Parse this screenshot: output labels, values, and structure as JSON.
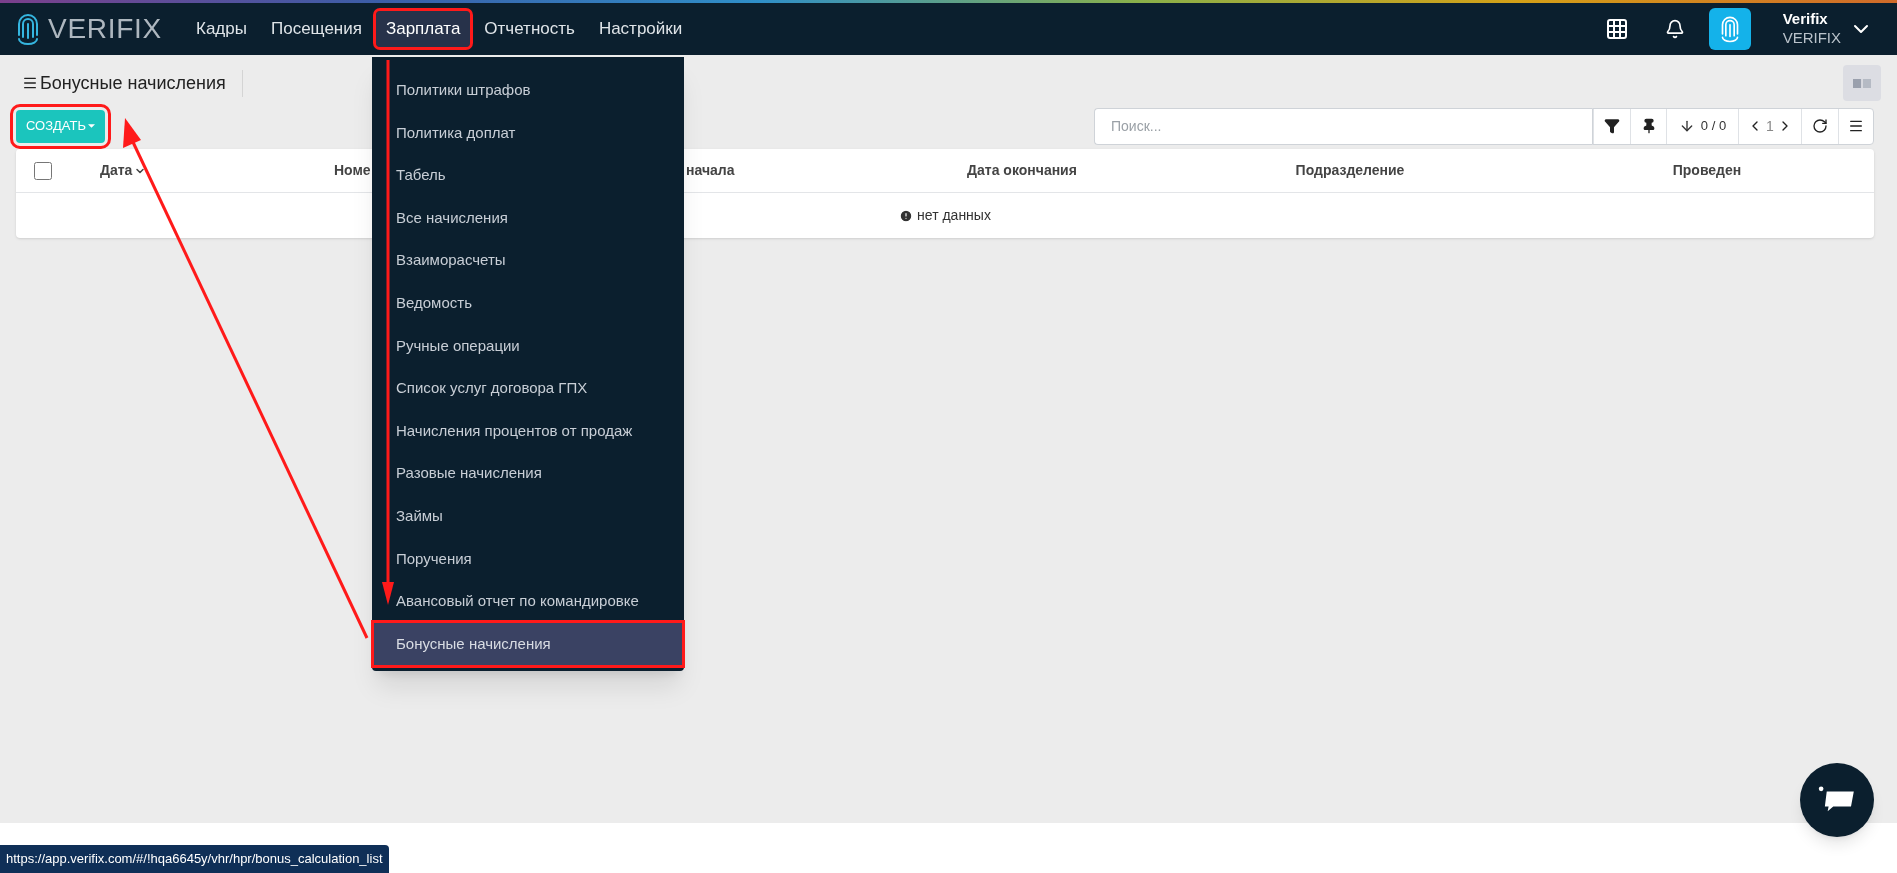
{
  "header": {
    "logo": "VERIFIX",
    "nav": [
      {
        "label": "Кадры",
        "selected": false
      },
      {
        "label": "Посещения",
        "selected": false
      },
      {
        "label": "Зарплата",
        "selected": true
      },
      {
        "label": "Отчетность",
        "selected": false
      },
      {
        "label": "Настройки",
        "selected": false
      }
    ],
    "user": {
      "name": "Verifix",
      "company": "VERIFIX"
    }
  },
  "menu": {
    "items": [
      {
        "label": "Политики штрафов",
        "selected": false
      },
      {
        "label": "Политика доплат",
        "selected": false
      },
      {
        "label": "Табель",
        "selected": false
      },
      {
        "label": "Все начисления",
        "selected": false
      },
      {
        "label": "Взаиморасчеты",
        "selected": false
      },
      {
        "label": "Ведомость",
        "selected": false
      },
      {
        "label": "Ручные операции",
        "selected": false
      },
      {
        "label": "Список услуг договора ГПХ",
        "selected": false
      },
      {
        "label": "Начисления процентов от продаж",
        "selected": false
      },
      {
        "label": "Разовые начисления",
        "selected": false
      },
      {
        "label": "Займы",
        "selected": false
      },
      {
        "label": "Поручения",
        "selected": false
      },
      {
        "label": "Авансовый отчет по командировке",
        "selected": false
      },
      {
        "label": "Бонусные начисления",
        "selected": true
      }
    ]
  },
  "page": {
    "title": "Бонусные начисления",
    "create_button": "СОЗДАТЬ",
    "search": {
      "placeholder": "Поиск..."
    },
    "counter": "0 / 0",
    "page": "1"
  },
  "table": {
    "select_all": {
      "checked": false
    },
    "columns": [
      {
        "label": "Дата",
        "sorted": true
      },
      {
        "label": "Номе",
        "sorted": false
      },
      {
        "label": "начала",
        "sorted": false
      },
      {
        "label": "Дата окончания",
        "sorted": false
      },
      {
        "label": "Подразделение",
        "sorted": false
      },
      {
        "label": "Проведен",
        "sorted": false
      }
    ],
    "empty_text": "нет данных"
  },
  "status_bar": {
    "url": "https://app.verifix.com/#/!hqa6645y/vhr/hpr/bonus_calculation_list"
  }
}
